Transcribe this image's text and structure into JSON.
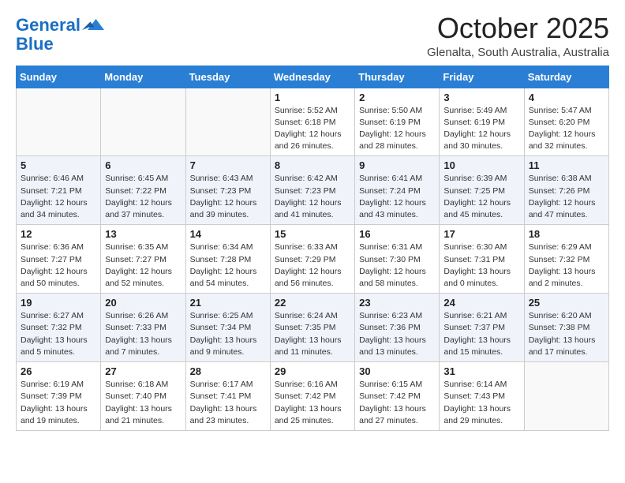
{
  "header": {
    "logo_line1": "General",
    "logo_line2": "Blue",
    "month": "October 2025",
    "location": "Glenalta, South Australia, Australia"
  },
  "days_of_week": [
    "Sunday",
    "Monday",
    "Tuesday",
    "Wednesday",
    "Thursday",
    "Friday",
    "Saturday"
  ],
  "weeks": [
    [
      {
        "day": "",
        "info": ""
      },
      {
        "day": "",
        "info": ""
      },
      {
        "day": "",
        "info": ""
      },
      {
        "day": "1",
        "info": "Sunrise: 5:52 AM\nSunset: 6:18 PM\nDaylight: 12 hours\nand 26 minutes."
      },
      {
        "day": "2",
        "info": "Sunrise: 5:50 AM\nSunset: 6:19 PM\nDaylight: 12 hours\nand 28 minutes."
      },
      {
        "day": "3",
        "info": "Sunrise: 5:49 AM\nSunset: 6:19 PM\nDaylight: 12 hours\nand 30 minutes."
      },
      {
        "day": "4",
        "info": "Sunrise: 5:47 AM\nSunset: 6:20 PM\nDaylight: 12 hours\nand 32 minutes."
      }
    ],
    [
      {
        "day": "5",
        "info": "Sunrise: 6:46 AM\nSunset: 7:21 PM\nDaylight: 12 hours\nand 34 minutes."
      },
      {
        "day": "6",
        "info": "Sunrise: 6:45 AM\nSunset: 7:22 PM\nDaylight: 12 hours\nand 37 minutes."
      },
      {
        "day": "7",
        "info": "Sunrise: 6:43 AM\nSunset: 7:23 PM\nDaylight: 12 hours\nand 39 minutes."
      },
      {
        "day": "8",
        "info": "Sunrise: 6:42 AM\nSunset: 7:23 PM\nDaylight: 12 hours\nand 41 minutes."
      },
      {
        "day": "9",
        "info": "Sunrise: 6:41 AM\nSunset: 7:24 PM\nDaylight: 12 hours\nand 43 minutes."
      },
      {
        "day": "10",
        "info": "Sunrise: 6:39 AM\nSunset: 7:25 PM\nDaylight: 12 hours\nand 45 minutes."
      },
      {
        "day": "11",
        "info": "Sunrise: 6:38 AM\nSunset: 7:26 PM\nDaylight: 12 hours\nand 47 minutes."
      }
    ],
    [
      {
        "day": "12",
        "info": "Sunrise: 6:36 AM\nSunset: 7:27 PM\nDaylight: 12 hours\nand 50 minutes."
      },
      {
        "day": "13",
        "info": "Sunrise: 6:35 AM\nSunset: 7:27 PM\nDaylight: 12 hours\nand 52 minutes."
      },
      {
        "day": "14",
        "info": "Sunrise: 6:34 AM\nSunset: 7:28 PM\nDaylight: 12 hours\nand 54 minutes."
      },
      {
        "day": "15",
        "info": "Sunrise: 6:33 AM\nSunset: 7:29 PM\nDaylight: 12 hours\nand 56 minutes."
      },
      {
        "day": "16",
        "info": "Sunrise: 6:31 AM\nSunset: 7:30 PM\nDaylight: 12 hours\nand 58 minutes."
      },
      {
        "day": "17",
        "info": "Sunrise: 6:30 AM\nSunset: 7:31 PM\nDaylight: 13 hours\nand 0 minutes."
      },
      {
        "day": "18",
        "info": "Sunrise: 6:29 AM\nSunset: 7:32 PM\nDaylight: 13 hours\nand 2 minutes."
      }
    ],
    [
      {
        "day": "19",
        "info": "Sunrise: 6:27 AM\nSunset: 7:32 PM\nDaylight: 13 hours\nand 5 minutes."
      },
      {
        "day": "20",
        "info": "Sunrise: 6:26 AM\nSunset: 7:33 PM\nDaylight: 13 hours\nand 7 minutes."
      },
      {
        "day": "21",
        "info": "Sunrise: 6:25 AM\nSunset: 7:34 PM\nDaylight: 13 hours\nand 9 minutes."
      },
      {
        "day": "22",
        "info": "Sunrise: 6:24 AM\nSunset: 7:35 PM\nDaylight: 13 hours\nand 11 minutes."
      },
      {
        "day": "23",
        "info": "Sunrise: 6:23 AM\nSunset: 7:36 PM\nDaylight: 13 hours\nand 13 minutes."
      },
      {
        "day": "24",
        "info": "Sunrise: 6:21 AM\nSunset: 7:37 PM\nDaylight: 13 hours\nand 15 minutes."
      },
      {
        "day": "25",
        "info": "Sunrise: 6:20 AM\nSunset: 7:38 PM\nDaylight: 13 hours\nand 17 minutes."
      }
    ],
    [
      {
        "day": "26",
        "info": "Sunrise: 6:19 AM\nSunset: 7:39 PM\nDaylight: 13 hours\nand 19 minutes."
      },
      {
        "day": "27",
        "info": "Sunrise: 6:18 AM\nSunset: 7:40 PM\nDaylight: 13 hours\nand 21 minutes."
      },
      {
        "day": "28",
        "info": "Sunrise: 6:17 AM\nSunset: 7:41 PM\nDaylight: 13 hours\nand 23 minutes."
      },
      {
        "day": "29",
        "info": "Sunrise: 6:16 AM\nSunset: 7:42 PM\nDaylight: 13 hours\nand 25 minutes."
      },
      {
        "day": "30",
        "info": "Sunrise: 6:15 AM\nSunset: 7:42 PM\nDaylight: 13 hours\nand 27 minutes."
      },
      {
        "day": "31",
        "info": "Sunrise: 6:14 AM\nSunset: 7:43 PM\nDaylight: 13 hours\nand 29 minutes."
      },
      {
        "day": "",
        "info": ""
      }
    ]
  ]
}
